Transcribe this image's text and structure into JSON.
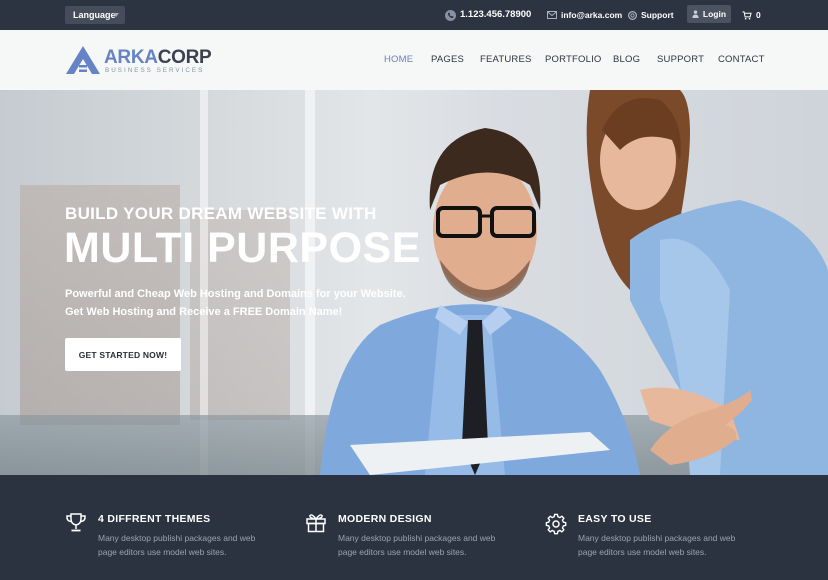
{
  "topbar": {
    "language": "Language",
    "phone": "1.123.456.78900",
    "email": "info@arka.com",
    "support": "Support",
    "login": "Login",
    "cart_count": "0"
  },
  "brand": {
    "name_a": "ARKA",
    "name_b": "CORP",
    "tagline": "BUSINESS SERVICES",
    "accent": "#6583c5"
  },
  "nav": [
    {
      "label": "HOME"
    },
    {
      "label": "PAGES"
    },
    {
      "label": "FEATURES"
    },
    {
      "label": "PORTFOLIO"
    },
    {
      "label": "BLOG"
    },
    {
      "label": "SUPPORT"
    },
    {
      "label": "CONTACT"
    }
  ],
  "hero": {
    "subtitle": "BUILD YOUR DREAM WEBSITE WITH",
    "title": "MULTI PURPOSE",
    "desc_line1": "Powerful and Cheap Web Hosting and Domains for your Website.",
    "desc_line2a": "Get Web Hosting and Receive a ",
    "desc_line2b": "FREE Domain Name!",
    "cta": "GET STARTED NOW!"
  },
  "features": [
    {
      "icon": "trophy-icon",
      "title": "4 DIFFRENT THEMES",
      "text": "Many desktop publishi packages and web page editors use model web sites."
    },
    {
      "icon": "gift-icon",
      "title": "MODERN DESIGN",
      "text": "Many desktop publishi packages and web page editors use model web sites."
    },
    {
      "icon": "gear-icon",
      "title": "EASY TO USE",
      "text": "Many desktop publishi packages and web page editors use model web sites."
    }
  ]
}
